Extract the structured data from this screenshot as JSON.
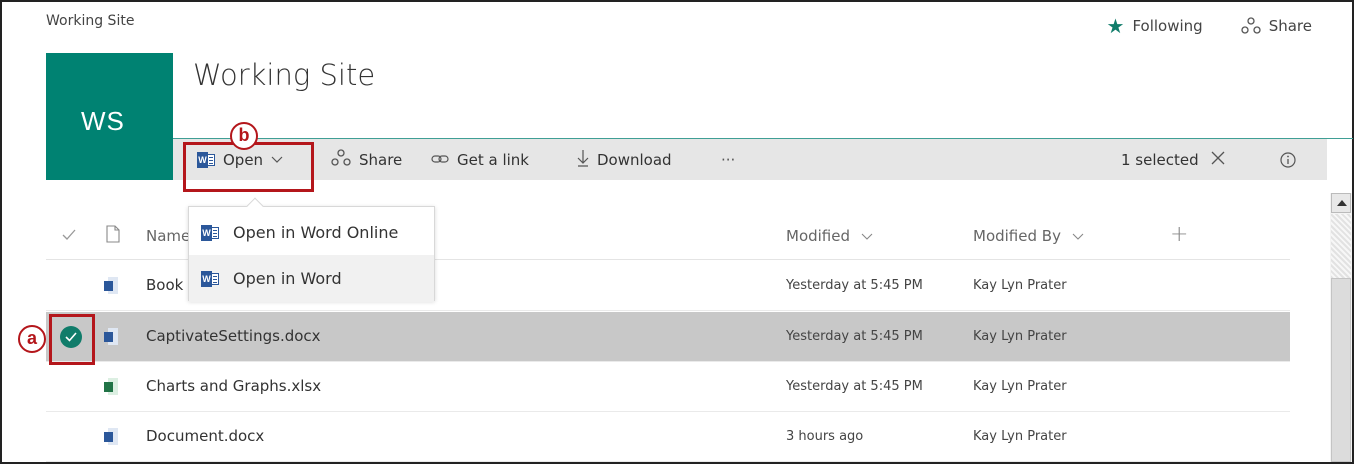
{
  "site": {
    "breadcrumb": "Working Site",
    "title": "Working Site",
    "logo_initials": "WS",
    "accent": "#008272"
  },
  "top_actions": {
    "following": "Following",
    "share": "Share"
  },
  "command_bar": {
    "open": "Open",
    "share": "Share",
    "get_link": "Get a link",
    "download": "Download",
    "more": "···",
    "selected": "1 selected",
    "clear_icon": "close-icon",
    "info_icon": "info-icon"
  },
  "open_menu": {
    "items": [
      {
        "label": "Open in Word Online",
        "icon": "word-icon"
      },
      {
        "label": "Open in Word",
        "icon": "word-icon"
      }
    ]
  },
  "list": {
    "columns": {
      "name": "Name",
      "modified": "Modified",
      "modified_by": "Modified By",
      "add": "+"
    },
    "rows": [
      {
        "name": "Book",
        "type": "docx",
        "modified": "Yesterday at 5:45 PM",
        "modified_by": "Kay Lyn Prater",
        "selected": false
      },
      {
        "name": "CaptivateSettings.docx",
        "type": "docx",
        "modified": "Yesterday at 5:45 PM",
        "modified_by": "Kay Lyn Prater",
        "selected": true
      },
      {
        "name": "Charts and Graphs.xlsx",
        "type": "xlsx",
        "modified": "Yesterday at 5:45 PM",
        "modified_by": "Kay Lyn Prater",
        "selected": false
      },
      {
        "name": "Document.docx",
        "type": "docx",
        "modified": "3 hours ago",
        "modified_by": "Kay Lyn Prater",
        "selected": false
      }
    ]
  },
  "annotations": {
    "a": "a",
    "b": "b",
    "color": "#b4161b"
  }
}
